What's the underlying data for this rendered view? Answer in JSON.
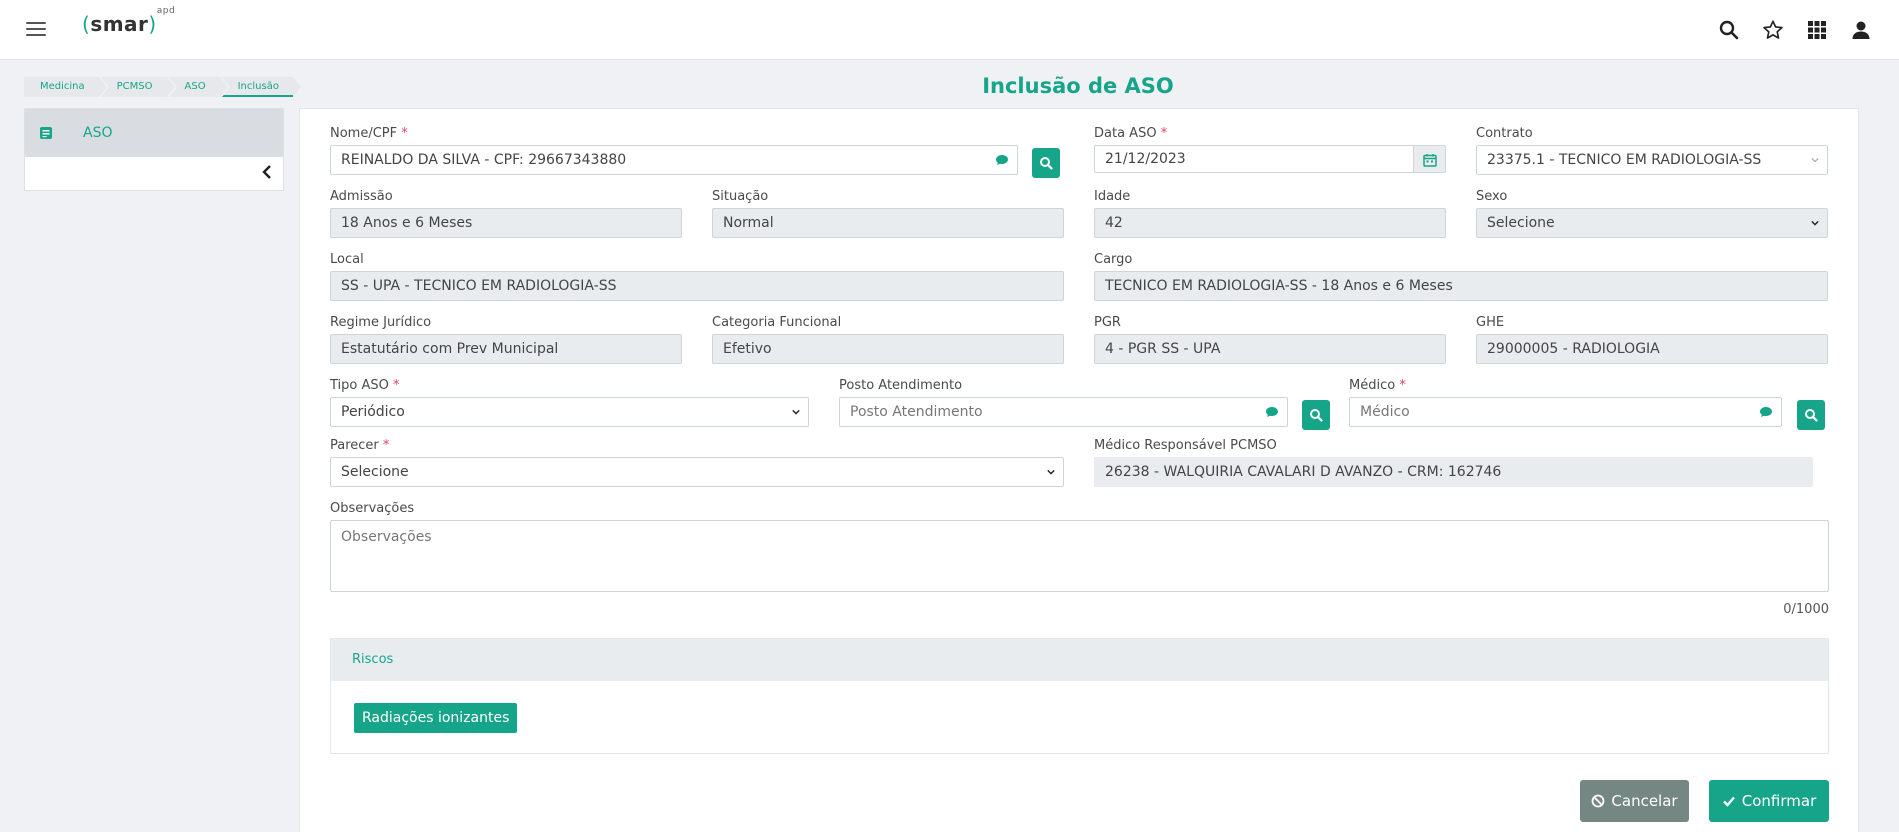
{
  "header": {
    "logo_text": "smar",
    "logo_sup": "apd",
    "icons": [
      "search-icon",
      "star-icon",
      "apps-grid-icon",
      "user-icon"
    ]
  },
  "breadcrumb": [
    "Medicina",
    "PCMSO",
    "ASO",
    "Inclusão"
  ],
  "page_title": "Inclusão de ASO",
  "sidebar": {
    "items": [
      {
        "label": "ASO",
        "icon": "document-icon"
      }
    ]
  },
  "form": {
    "nome_cpf": {
      "label": "Nome/CPF",
      "value": "REINALDO DA SILVA - CPF: 29667343880"
    },
    "data_aso": {
      "label": "Data ASO",
      "value": "21/12/2023"
    },
    "contrato": {
      "label": "Contrato",
      "value": "23375.1 - TECNICO EM RADIOLOGIA-SS"
    },
    "admissao": {
      "label": "Admissão",
      "value": "18 Anos e 6 Meses"
    },
    "situacao": {
      "label": "Situação",
      "value": "Normal"
    },
    "idade": {
      "label": "Idade",
      "value": "42"
    },
    "sexo": {
      "label": "Sexo",
      "value": "Selecione"
    },
    "local": {
      "label": "Local",
      "value": "SS - UPA - TECNICO EM RADIOLOGIA-SS"
    },
    "cargo": {
      "label": "Cargo",
      "value": "TECNICO EM RADIOLOGIA-SS - 18 Anos e 6 Meses"
    },
    "regime": {
      "label": "Regime Jurídico",
      "value": "Estatutário com Prev Municipal"
    },
    "categoria": {
      "label": "Categoria Funcional",
      "value": "Efetivo"
    },
    "pgr": {
      "label": "PGR",
      "value": "4 - PGR SS - UPA"
    },
    "ghe": {
      "label": "GHE",
      "value": "29000005 - RADIOLOGIA"
    },
    "tipo_aso": {
      "label": "Tipo ASO",
      "value": "Periódico"
    },
    "posto": {
      "label": "Posto Atendimento",
      "placeholder": "Posto Atendimento"
    },
    "medico": {
      "label": "Médico",
      "placeholder": "Médico"
    },
    "parecer": {
      "label": "Parecer",
      "value": "Selecione"
    },
    "medico_resp": {
      "label": "Médico Responsável PCMSO",
      "value": "26238 - WALQUIRIA CAVALARI D AVANZO - CRM: 162746"
    },
    "observacoes": {
      "label": "Observações",
      "placeholder": "Observações",
      "counter": "0/1000"
    }
  },
  "riscos": {
    "title": "Riscos",
    "items": [
      "Radiações ionizantes"
    ]
  },
  "actions": {
    "cancel": "Cancelar",
    "confirm": "Confirmar"
  },
  "colors": {
    "accent": "#16a589",
    "required": "#e0405a",
    "cancel": "#758783"
  }
}
